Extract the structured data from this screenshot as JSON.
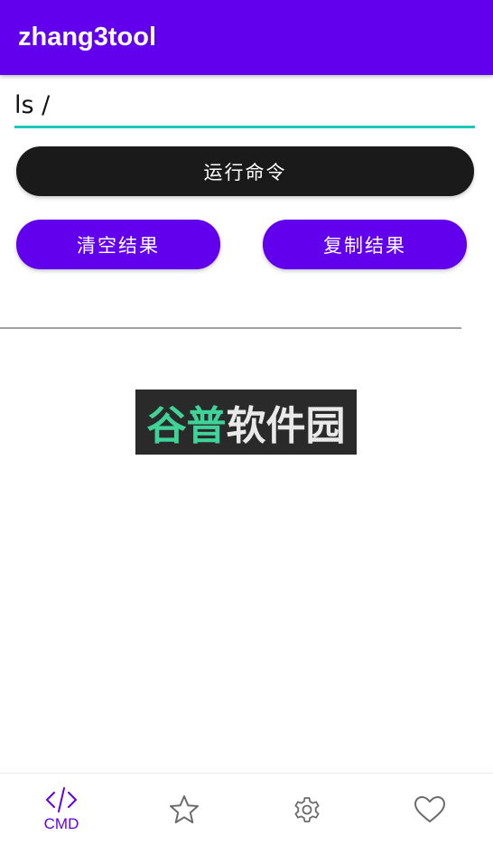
{
  "app_bar": {
    "title": "zhang3tool"
  },
  "command": {
    "value": "ls /"
  },
  "buttons": {
    "run": "运行命令",
    "clear": "清空结果",
    "copy": "复制结果"
  },
  "watermark": {
    "part1": "谷普",
    "part2": "软件园"
  },
  "bottom_nav": {
    "items": [
      {
        "icon": "code-icon",
        "label": "CMD",
        "active": true
      },
      {
        "icon": "star-icon",
        "label": "",
        "active": false
      },
      {
        "icon": "gear-icon",
        "label": "",
        "active": false
      },
      {
        "icon": "heart-icon",
        "label": "",
        "active": false
      }
    ]
  },
  "colors": {
    "primary": "#6200ee",
    "accent": "#1fc8b8",
    "dark_button": "#1a1a1a",
    "inactive_icon": "#6b6b6b"
  }
}
